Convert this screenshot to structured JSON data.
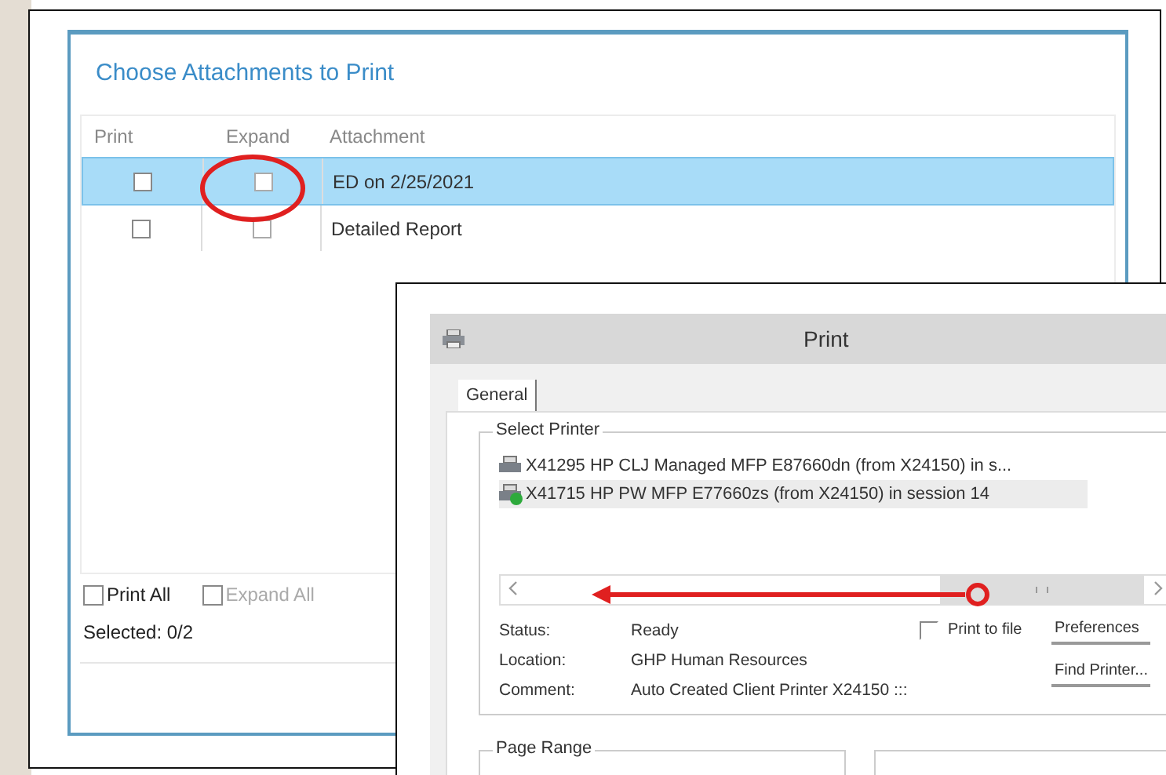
{
  "attachments_dialog": {
    "title": "Choose Attachments to Print",
    "columns": [
      "Print",
      "Expand",
      "Attachment"
    ],
    "rows": [
      {
        "print_checked": false,
        "expand_checked": false,
        "attachment": "ED on 2/25/2021",
        "selected": true
      },
      {
        "print_checked": false,
        "expand_checked": false,
        "attachment": "Detailed Report",
        "selected": false
      }
    ],
    "print_all": {
      "label": "Print All",
      "checked": false,
      "disabled": false
    },
    "expand_all": {
      "label": "Expand All",
      "checked": false,
      "disabled": true
    },
    "selected_count": "Selected: 0/2"
  },
  "print_dialog": {
    "title": "Print",
    "tabs": [
      {
        "label": "General",
        "selected": true
      }
    ],
    "select_printer": {
      "label": "Select Printer",
      "printers": [
        {
          "name": "X41295 HP CLJ Managed MFP E87660dn (from X24150) in s...",
          "selected": false,
          "default": false
        },
        {
          "name": "X41715 HP PW MFP E77660zs (from X24150) in session 14",
          "selected": true,
          "default": true
        }
      ]
    },
    "info": [
      {
        "label": "Status:",
        "value": "Ready"
      },
      {
        "label": "Location:",
        "value": "GHP Human Resources"
      },
      {
        "label": "Comment:",
        "value": "Auto Created Client Printer X24150 :::"
      }
    ],
    "print_to_file": {
      "label": "Print to file",
      "checked": false
    },
    "buttons": [
      "Preferences",
      "Find Printer..."
    ],
    "page_range": {
      "label": "Page Range"
    }
  }
}
